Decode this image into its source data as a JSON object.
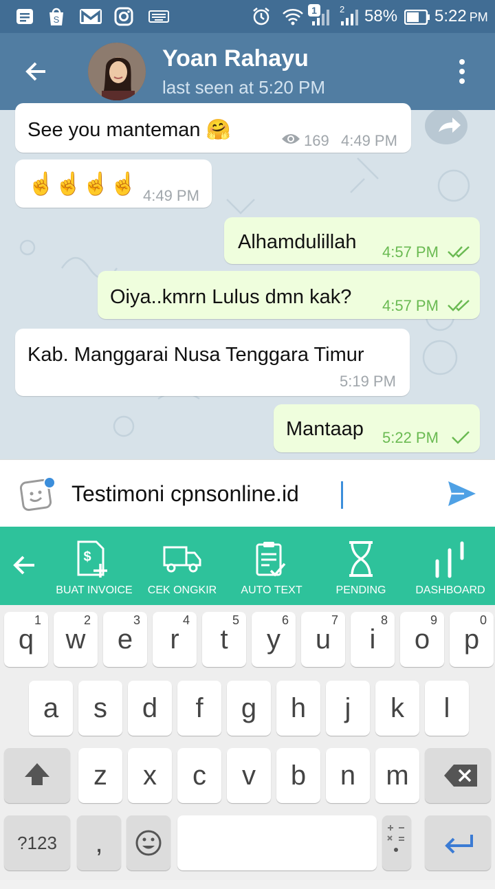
{
  "status_bar": {
    "battery_percent": "58%",
    "time": "5:22",
    "time_suffix": "PM",
    "sim_badge": "1",
    "sim2_label": "2"
  },
  "header": {
    "contact_name": "Yoan Rahayu",
    "last_seen": "last seen at 5:20 PM"
  },
  "messages": [
    {
      "type": "in",
      "text": "See you manteman 🤗",
      "views": "169",
      "time": "4:49 PM"
    },
    {
      "type": "in",
      "text": "☝☝☝☝",
      "time": "4:49 PM"
    },
    {
      "type": "out",
      "text": "Alhamdulillah",
      "time": "4:57 PM",
      "status": "read"
    },
    {
      "type": "out",
      "text": "Oiya..kmrn Lulus dmn kak?",
      "time": "4:57 PM",
      "status": "read"
    },
    {
      "type": "in",
      "text": "Kab. Manggarai Nusa Tenggara Timur",
      "time": "5:19 PM"
    },
    {
      "type": "out",
      "text": "Mantaap",
      "time": "5:22 PM",
      "status": "sent"
    }
  ],
  "input": {
    "value": "Testimoni cpnsonline.id"
  },
  "toolbar": {
    "items": [
      {
        "label": "BUAT INVOICE",
        "icon": "invoice-icon"
      },
      {
        "label": "CEK ONGKIR",
        "icon": "truck-icon"
      },
      {
        "label": "AUTO TEXT",
        "icon": "clipboard-check-icon"
      },
      {
        "label": "PENDING",
        "icon": "hourglass-icon"
      },
      {
        "label": "DASHBOARD",
        "icon": "bars-icon"
      }
    ]
  },
  "keyboard": {
    "row1": [
      "q",
      "w",
      "e",
      "r",
      "t",
      "y",
      "u",
      "i",
      "o",
      "p"
    ],
    "row1_nums": [
      "1",
      "2",
      "3",
      "4",
      "5",
      "6",
      "7",
      "8",
      "9",
      "0"
    ],
    "row2": [
      "a",
      "s",
      "d",
      "f",
      "g",
      "h",
      "j",
      "k",
      "l"
    ],
    "row3": [
      "z",
      "x",
      "c",
      "v",
      "b",
      "n",
      "m"
    ],
    "symbols_key": "?123",
    "comma_key": ","
  },
  "colors": {
    "header": "#517da2",
    "toolbar": "#2ec29b",
    "out_bubble": "#effedd",
    "accent": "#3b8edb"
  }
}
